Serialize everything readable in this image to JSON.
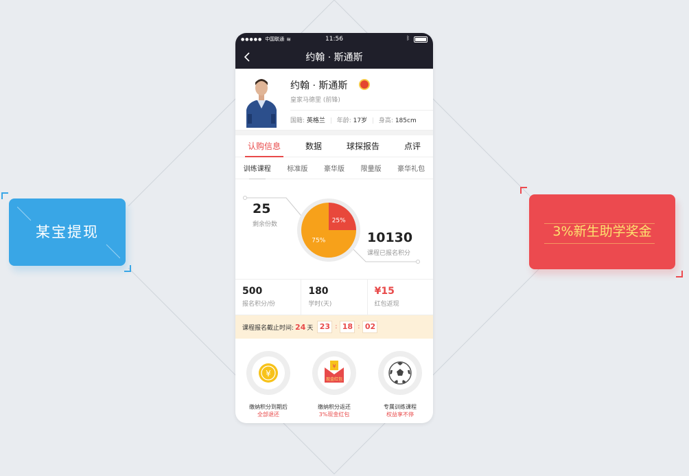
{
  "status_bar": {
    "carrier": "中国联通",
    "time": "11:56"
  },
  "nav": {
    "title": "约翰 · 斯通斯"
  },
  "player": {
    "name": "约翰 · 斯通斯",
    "team": "皇家马德里 (前锋)",
    "nationality_label": "国籍:",
    "nationality": "英格兰",
    "age_label": "年龄:",
    "age": "17岁",
    "height_label": "身高:",
    "height": "185cm"
  },
  "tabs": [
    {
      "label": "认购信息",
      "active": true
    },
    {
      "label": "数据",
      "active": false
    },
    {
      "label": "球探报告",
      "active": false
    },
    {
      "label": "点评",
      "active": false
    }
  ],
  "subtabs": [
    {
      "label": "训练课程",
      "active": true
    },
    {
      "label": "标准版",
      "active": false
    },
    {
      "label": "豪华版",
      "active": false
    },
    {
      "label": "限量版",
      "active": false
    },
    {
      "label": "豪华礼包",
      "active": false
    }
  ],
  "summary": {
    "remaining_value": "25",
    "remaining_label": "剩余份数",
    "points_value": "10130",
    "points_label": "课程已报名积分"
  },
  "chart_data": {
    "type": "pie",
    "slices": [
      {
        "label": "25%",
        "value": 25,
        "color": "#e8483b"
      },
      {
        "label": "75%",
        "value": 75,
        "color": "#f7a11a"
      }
    ]
  },
  "stats": [
    {
      "value": "500",
      "label": "报名积分/份",
      "red": false
    },
    {
      "value": "180",
      "label": "学时(天)",
      "red": false
    },
    {
      "value": "¥15",
      "label": "红包返现",
      "red": true
    }
  ],
  "deadline": {
    "label": "课程报名截止时间:",
    "days": "24",
    "days_unit": "天",
    "hours": "23",
    "minutes": "18",
    "seconds": "02"
  },
  "benefits": [
    {
      "icon": "coin-icon",
      "label": "缴纳积分到期后",
      "sub": "全部退还"
    },
    {
      "icon": "red-envelope-icon",
      "label": "缴纳积分返还",
      "sub": "3%现金红包",
      "icon_text": "现金红包"
    },
    {
      "icon": "soccer-ball-icon",
      "label": "专属训练课程",
      "sub": "权益享不停"
    }
  ],
  "left_badge": {
    "label": "某宝提现",
    "color": "#39a6e6"
  },
  "right_badge": {
    "label": "3%新生助学奖金",
    "color": "#ec4a4f",
    "text_color": "#fde36f"
  }
}
